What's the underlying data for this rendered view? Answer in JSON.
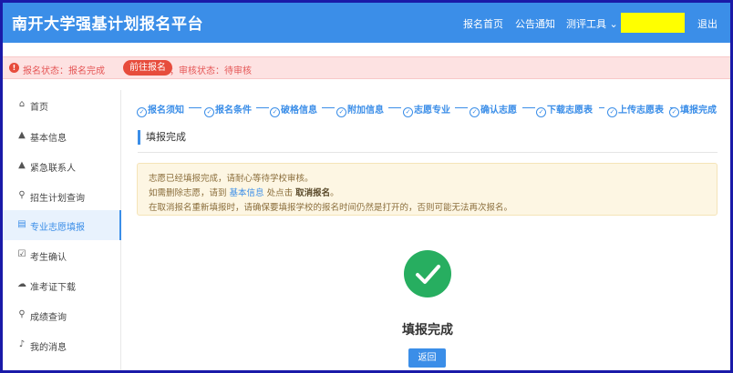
{
  "header": {
    "brand": "南开大学强基计划报名平台",
    "nav": {
      "home": "报名首页",
      "notice": "公告通知",
      "tools": "测评工具 ⌄",
      "logout": "退出"
    },
    "user_box_color": "#ffff00"
  },
  "alert": {
    "icon": "!",
    "status_text": "报名状态：报名完成",
    "goto_label": "前往报名",
    "review_text": "；审核状态：待审核"
  },
  "sidebar": {
    "items": [
      {
        "icon": "home-icon",
        "glyph": "⌂",
        "label": "首页"
      },
      {
        "icon": "user-icon",
        "glyph": "▲",
        "label": "基本信息"
      },
      {
        "icon": "contact-icon",
        "glyph": "▲",
        "label": "紧急联系人"
      },
      {
        "icon": "search-icon",
        "glyph": "⚲",
        "label": "招生计划查询"
      },
      {
        "icon": "document-icon",
        "glyph": "▤",
        "label": "专业志愿填报"
      },
      {
        "icon": "checkbox-icon",
        "glyph": "☑",
        "label": "考生确认"
      },
      {
        "icon": "cloud-download-icon",
        "glyph": "☁",
        "label": "准考证下载"
      },
      {
        "icon": "search-icon",
        "glyph": "⚲",
        "label": "成绩查询"
      },
      {
        "icon": "bell-icon",
        "glyph": "♪",
        "label": "我的消息"
      }
    ],
    "active_index": 4
  },
  "steps": [
    "报名须知",
    "报名条件",
    "破格信息",
    "附加信息",
    "志愿专业",
    "确认志愿",
    "下载志愿表",
    "上传志愿表",
    "填报完成"
  ],
  "section_title": "填报完成",
  "info": {
    "line1": "志愿已经填报完成，请耐心等待学校审核。",
    "line2_pre": "如需删除志愿，请到 ",
    "line2_link": "基本信息",
    "line2_mid": " 处点击 ",
    "line2_strong": "取消报名",
    "line2_post": "。",
    "line3": "在取消报名重新填报时，请确保要填报学校的报名时间仍然是打开的，否则可能无法再次报名。"
  },
  "result": {
    "title": "填报完成",
    "back_label": "返回"
  },
  "colors": {
    "primary": "#3b8ee8",
    "success": "#27ae60",
    "danger": "#e74c3c"
  }
}
